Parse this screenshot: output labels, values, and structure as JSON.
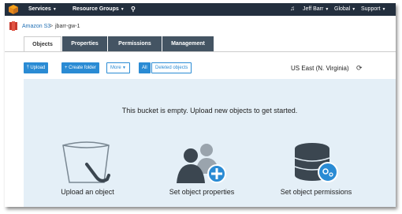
{
  "topbar": {
    "services": "Services",
    "resource_groups": "Resource Groups",
    "user": "Jeff Barr",
    "region": "Global",
    "support": "Support"
  },
  "breadcrumb": {
    "root": "Amazon S3",
    "separator": ">",
    "bucket": "jbarr-gw-1"
  },
  "tabs": [
    "Objects",
    "Properties",
    "Permissions",
    "Management"
  ],
  "toolbar": {
    "upload": "Upload",
    "create_folder": "Create folder",
    "more": "More",
    "all": "All",
    "deleted_objects": "Deleted objects",
    "region": "US East (N. Virginia)"
  },
  "empty_state": {
    "message": "This bucket is empty. Upload new objects to get started.",
    "cards": [
      "Upload an object",
      "Set object properties",
      "Set object permissions"
    ]
  },
  "colors": {
    "topbar": "#232f3e",
    "accent": "#2a8bd4",
    "tab_inactive": "#445463",
    "panel": "#e4eff7"
  }
}
